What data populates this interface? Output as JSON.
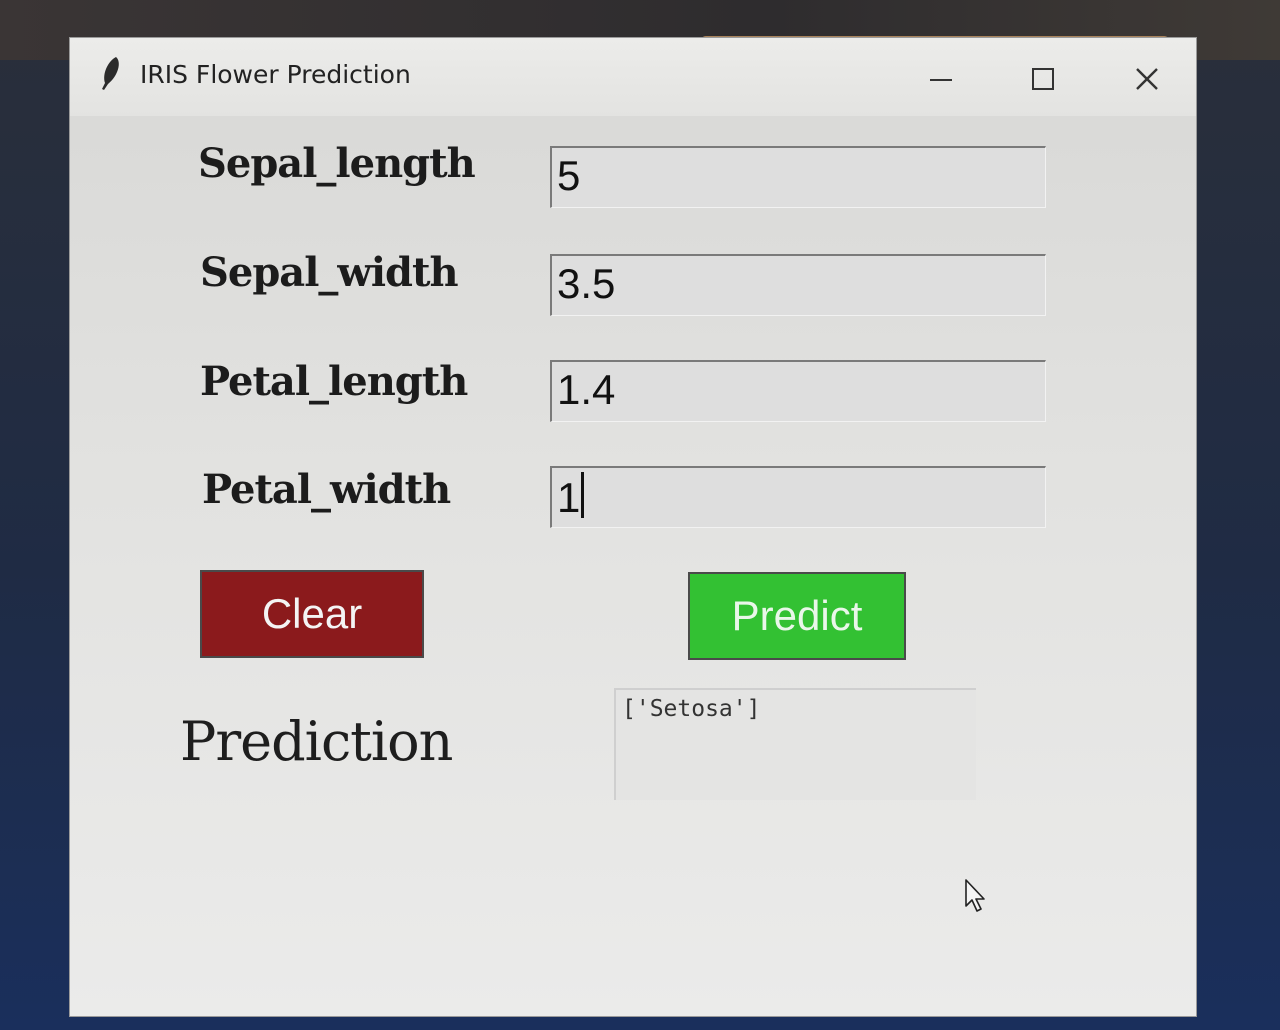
{
  "window": {
    "title": "IRIS Flower Prediction"
  },
  "fields": [
    {
      "label": "Sepal_length",
      "value": "5"
    },
    {
      "label": "Sepal_width",
      "value": "3.5"
    },
    {
      "label": "Petal_length",
      "value": "1.4"
    },
    {
      "label": "Petal_width",
      "value": "1"
    }
  ],
  "buttons": {
    "clear": "Clear",
    "predict": "Predict"
  },
  "prediction": {
    "label": "Prediction",
    "result": "['Setosa']"
  },
  "colors": {
    "clear_button": "#8b1a1c",
    "predict_button": "#33c133",
    "window_background": "#e2e2e0"
  },
  "icons": {
    "app": "feather-icon",
    "minimize": "minimize-icon",
    "maximize": "maximize-icon",
    "close": "close-icon",
    "pointer": "mouse-pointer-icon"
  }
}
